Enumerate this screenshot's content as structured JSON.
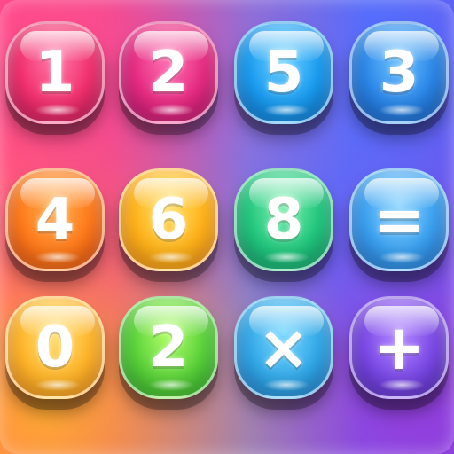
{
  "keypad": {
    "rows": [
      [
        {
          "label": "1",
          "name": "key-1-button",
          "color": "#f2306f"
        },
        {
          "label": "2",
          "name": "key-2-button",
          "color": "#e62a82"
        },
        {
          "label": "5",
          "name": "key-5-button",
          "color": "#1a9bf0"
        },
        {
          "label": "3",
          "name": "key-3-button",
          "color": "#2a86e8"
        }
      ],
      [
        {
          "label": "4",
          "name": "key-4-button",
          "color": "#ff7a1a"
        },
        {
          "label": "6",
          "name": "key-6-button",
          "color": "#ffb21a"
        },
        {
          "label": "8",
          "name": "key-8-button",
          "color": "#22c77e"
        },
        {
          "label": "=",
          "name": "equals-button",
          "color": "#3aa0f0"
        }
      ],
      [
        {
          "label": "0",
          "name": "key-0-button",
          "color": "#ffb52a"
        },
        {
          "label": "2",
          "name": "key-2-alt-button",
          "color": "#5ad23a"
        },
        {
          "label": "×",
          "name": "multiply-button",
          "color": "#32a8e8"
        },
        {
          "label": "+",
          "name": "plus-button",
          "color": "#7a48e6"
        }
      ]
    ]
  }
}
